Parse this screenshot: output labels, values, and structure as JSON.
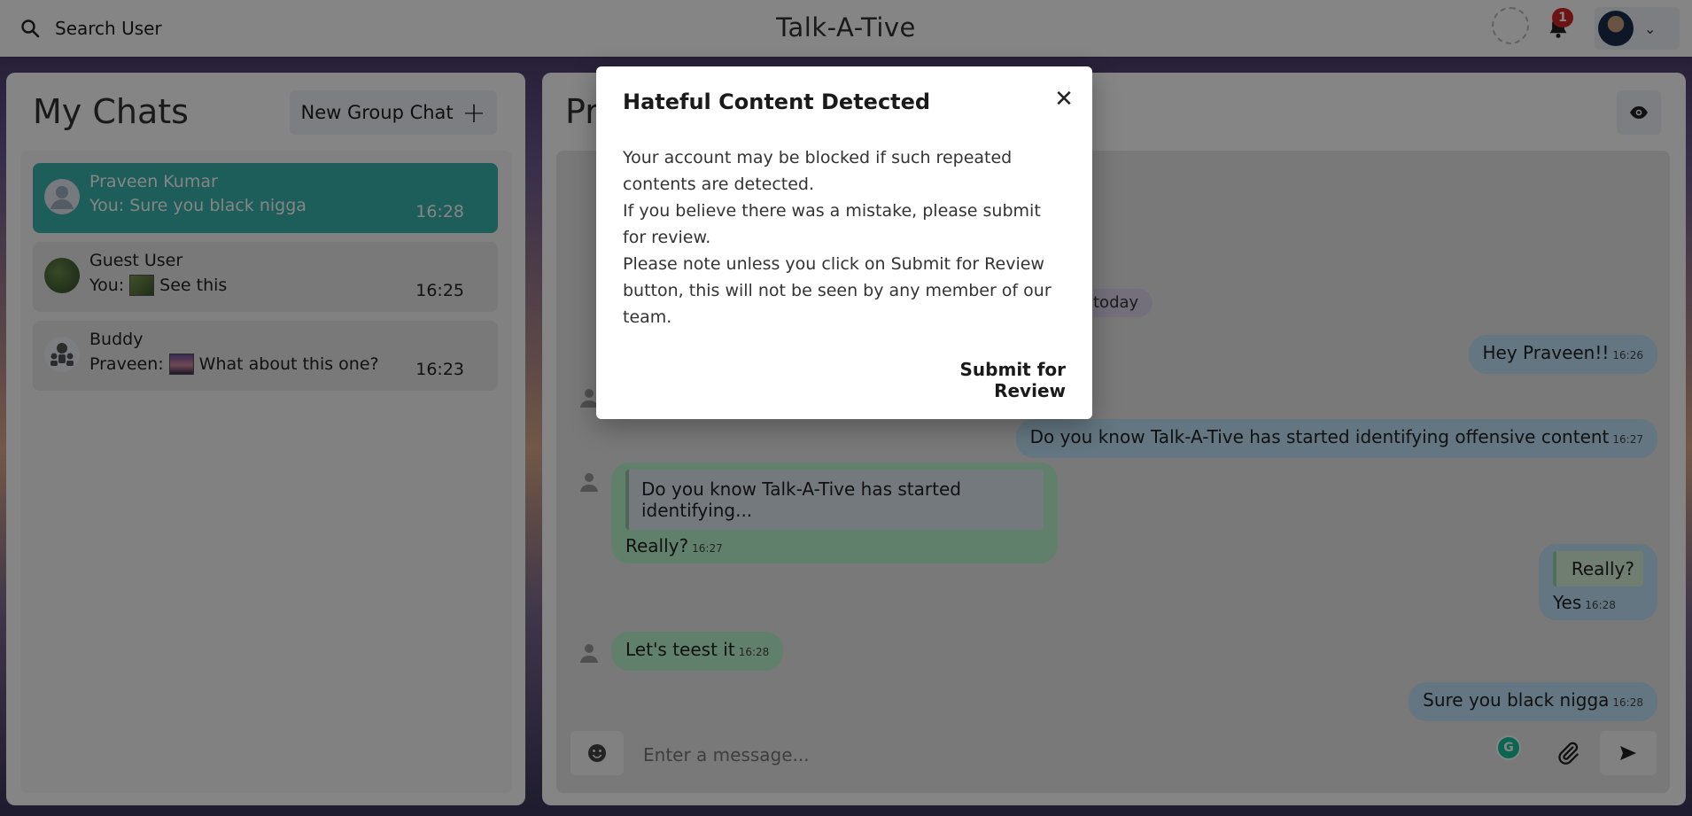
{
  "topbar": {
    "search_label": "Search User",
    "brand": "Talk-A-Tive",
    "notification_count": "1"
  },
  "sidebar": {
    "title": "My Chats",
    "new_group_label": "New Group Chat",
    "chats": [
      {
        "name": "Praveen Kumar",
        "message": "You: Sure you black nigga",
        "time": "16:28"
      },
      {
        "name": "Guest User",
        "prefix": "You:",
        "message": "See this",
        "time": "16:25"
      },
      {
        "name": "Buddy",
        "prefix": "Praveen:",
        "message": "What about this one?",
        "time": "16:23"
      }
    ]
  },
  "chat": {
    "title": "Pr",
    "date_chip": "today",
    "messages": [
      {
        "text": "Hey Praveen!!",
        "time": "16:26"
      },
      {
        "text": "Do you know Talk-A-Tive has started identifying offensive content",
        "time": "16:27"
      },
      {
        "quote": "Do you know Talk-A-Tive has started identifying...",
        "text": "Really?",
        "time": "16:27"
      },
      {
        "quote": "Really?",
        "text": "Yes",
        "time": "16:28"
      },
      {
        "text": "Let's teest it",
        "time": "16:28"
      },
      {
        "text": "Sure you black nigga",
        "time": "16:28"
      }
    ],
    "input_placeholder": "Enter a message..."
  },
  "modal": {
    "title": "Hateful Content Detected",
    "body": [
      "Your account may be blocked if such repeated contents are detected.",
      "If you believe there was a mistake, please submit for review.",
      "Please note unless you click on Submit for Review button, this will not be seen by any member of our team."
    ],
    "submit_label": "Submit for Review"
  }
}
